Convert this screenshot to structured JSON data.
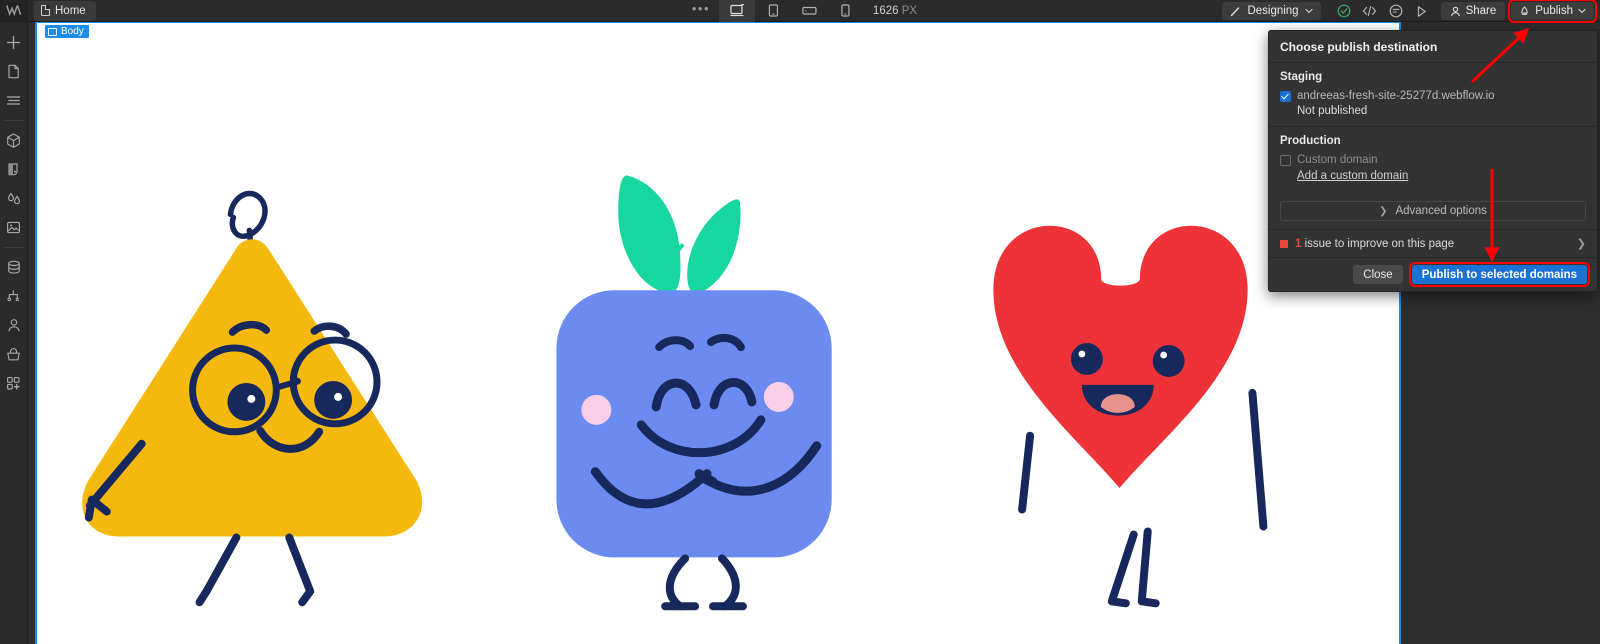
{
  "app": {
    "name": "Webflow Designer",
    "logo_icon": "webflow-logo-icon"
  },
  "topbar": {
    "page_tab": {
      "label": "Home",
      "icon": "page-icon"
    },
    "overflow_icon": "ellipsis-icon",
    "breakpoints": [
      {
        "name": "desktop-breakpoint",
        "icon": "desktop-icon",
        "active": true
      },
      {
        "name": "tablet-breakpoint",
        "icon": "tablet-icon",
        "active": false
      },
      {
        "name": "mobile-landscape-breakpoint",
        "icon": "mobile-landscape-icon",
        "active": false
      },
      {
        "name": "mobile-portrait-breakpoint",
        "icon": "mobile-portrait-icon",
        "active": false
      }
    ],
    "viewport_value": "1626",
    "viewport_unit": "PX",
    "mode_pill": {
      "label": "Designing",
      "icon": "brush-icon",
      "caret": "chevron-down-icon"
    },
    "status_icons": [
      {
        "name": "check-circle-icon",
        "color": "#3aa76d"
      },
      {
        "name": "code-icon"
      },
      {
        "name": "comment-icon"
      },
      {
        "name": "preview-play-icon"
      }
    ],
    "share": {
      "label": "Share",
      "icon": "person-icon"
    },
    "publish": {
      "label": "Publish",
      "icon": "publish-rocket-icon",
      "caret": "chevron-down-icon",
      "highlighted": true
    }
  },
  "left_rail": [
    {
      "name": "add-element-button",
      "icon": "plus-icon"
    },
    {
      "name": "pages-button",
      "icon": "page-icon"
    },
    {
      "name": "navigator-button",
      "icon": "layers-icon"
    },
    {
      "name": "components-button",
      "icon": "cube-icon"
    },
    {
      "name": "style-manager-button",
      "icon": "paint-icon"
    },
    {
      "name": "variables-button",
      "icon": "drops-icon"
    },
    {
      "name": "assets-button",
      "icon": "image-icon"
    },
    {
      "name": "cms-button",
      "icon": "database-icon"
    },
    {
      "name": "logic-button",
      "icon": "logic-branch-icon"
    },
    {
      "name": "users-button",
      "icon": "person-icon"
    },
    {
      "name": "ecommerce-button",
      "icon": "basket-icon"
    },
    {
      "name": "apps-button",
      "icon": "apps-grid-icon"
    }
  ],
  "canvas": {
    "selected_element_tag": "Body",
    "tag_icon": "body-box-icon",
    "illustration": {
      "characters": [
        {
          "name": "yellow-triangle-character",
          "body_color": "#F5B80F",
          "stroke_color": "#17295C",
          "features": "glasses, eyebrows, smile, one arm, two legs, curly antenna"
        },
        {
          "name": "blue-square-character",
          "body_color": "#6B8BF0",
          "stroke_color": "#17295C",
          "leaf_color": "#17D6A0",
          "cheek_color": "#FAD0E8",
          "features": "two leaves, closed eyes, blush cheeks, crossed arms, two legs"
        },
        {
          "name": "red-heart-character",
          "body_color": "#ED3338",
          "stroke_color": "#17295C",
          "tongue_color": "#E8928E",
          "features": "open mouth with tongue, two eyes, two arms, two legs"
        }
      ]
    }
  },
  "publish_panel": {
    "title": "Choose publish destination",
    "staging": {
      "heading": "Staging",
      "domain": "andreeas-fresh-site-25277d.webflow.io",
      "checked": true,
      "status": "Not published"
    },
    "production": {
      "heading": "Production",
      "custom_domain_label": "Custom domain",
      "custom_domain_checked": false,
      "add_domain_link": "Add a custom domain"
    },
    "advanced": {
      "label": "Advanced options",
      "chevron": "chevron-right-icon"
    },
    "issue": {
      "count": "1",
      "text": "issue to improve on this page",
      "chevron": "chevron-right-icon",
      "color": "#e8453c"
    },
    "footer": {
      "close_label": "Close",
      "publish_label": "Publish to selected domains",
      "publish_highlighted": true,
      "publish_color": "#1b72d4"
    }
  },
  "annotations": {
    "arrow_color": "#ff0000",
    "items": [
      {
        "name": "arrow-to-publish-button",
        "target": "Publish button"
      },
      {
        "name": "arrow-to-publish-to-selected-domains",
        "target": "Publish to selected domains button"
      }
    ]
  }
}
